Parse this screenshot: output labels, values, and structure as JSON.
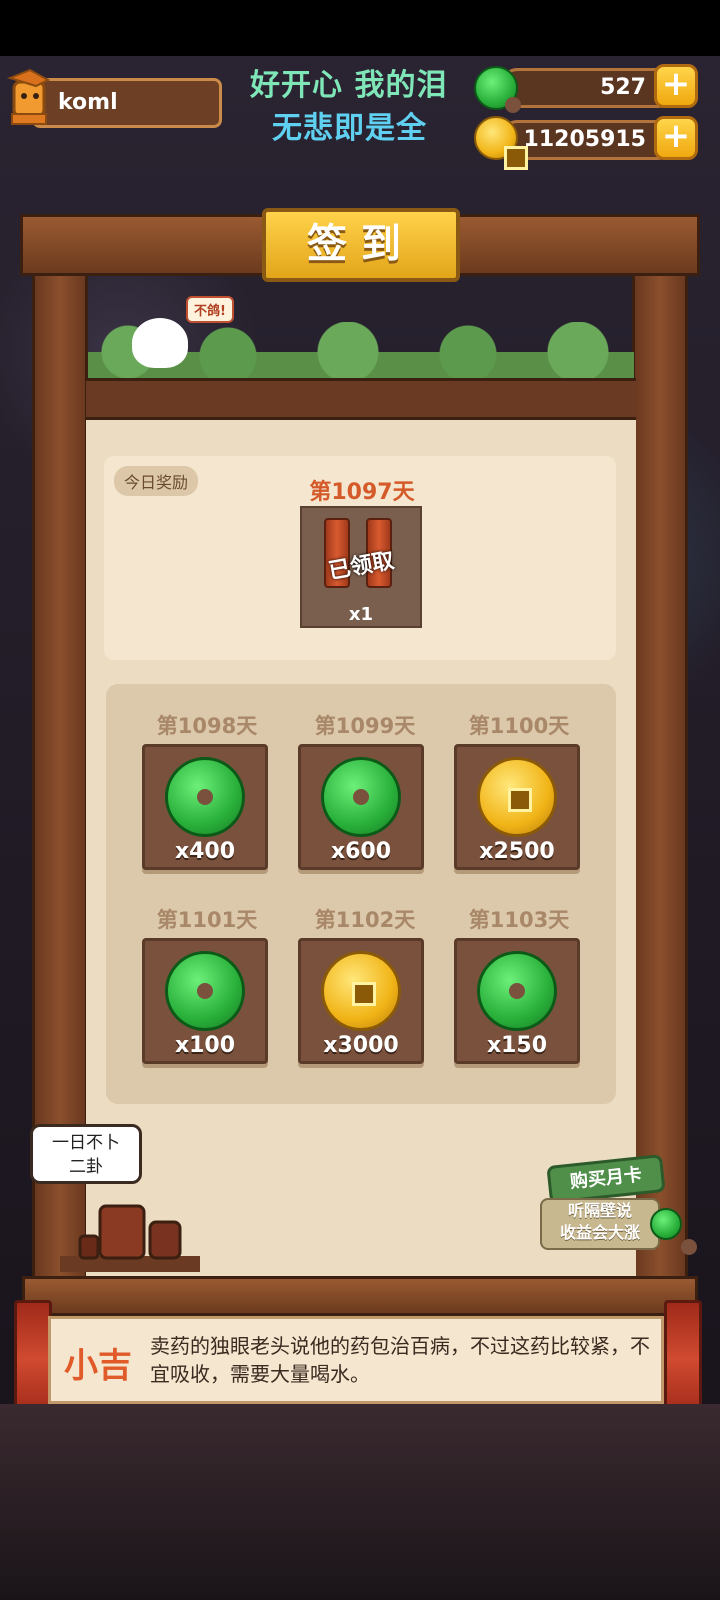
{
  "player": {
    "name": "koml"
  },
  "motto": {
    "line1": "好开心 我的泪",
    "line2": "无悲即是全"
  },
  "resources": {
    "jade": {
      "value": "527",
      "icon": "jade-icon"
    },
    "coins": {
      "value": "11205915",
      "icon": "coin-icon"
    },
    "add_label": "+"
  },
  "title": "签到",
  "npc_bubble": "不鸽!",
  "today": {
    "tag": "今日奖励",
    "day": "第1097天",
    "status": "已领取",
    "count": "x1",
    "icon": "firecracker-icon"
  },
  "rewards": [
    {
      "day": "第1098天",
      "qty": "x400",
      "type": "jade"
    },
    {
      "day": "第1099天",
      "qty": "x600",
      "type": "jade"
    },
    {
      "day": "第1100天",
      "qty": "x2500",
      "type": "coin"
    },
    {
      "day": "第1101天",
      "qty": "x100",
      "type": "jade"
    },
    {
      "day": "第1102天",
      "qty": "x3000",
      "type": "coin"
    },
    {
      "day": "第1103天",
      "qty": "x150",
      "type": "jade"
    }
  ],
  "fortune_bubble": {
    "line1": "一日不卜",
    "line2": "二卦"
  },
  "monthly_card": {
    "label": "购买月卡",
    "sub1": "听隔壁说",
    "sub2": "收益会大涨"
  },
  "tip": {
    "speaker": "小吉",
    "text": "卖药的独眼老头说他的药包治百病，不过这药比较紧，不宜吸收，需要大量喝水。"
  },
  "colors": {
    "accent_gold": "#f0a810",
    "day_highlight": "#d55a2a",
    "wood": "#6a3920"
  }
}
